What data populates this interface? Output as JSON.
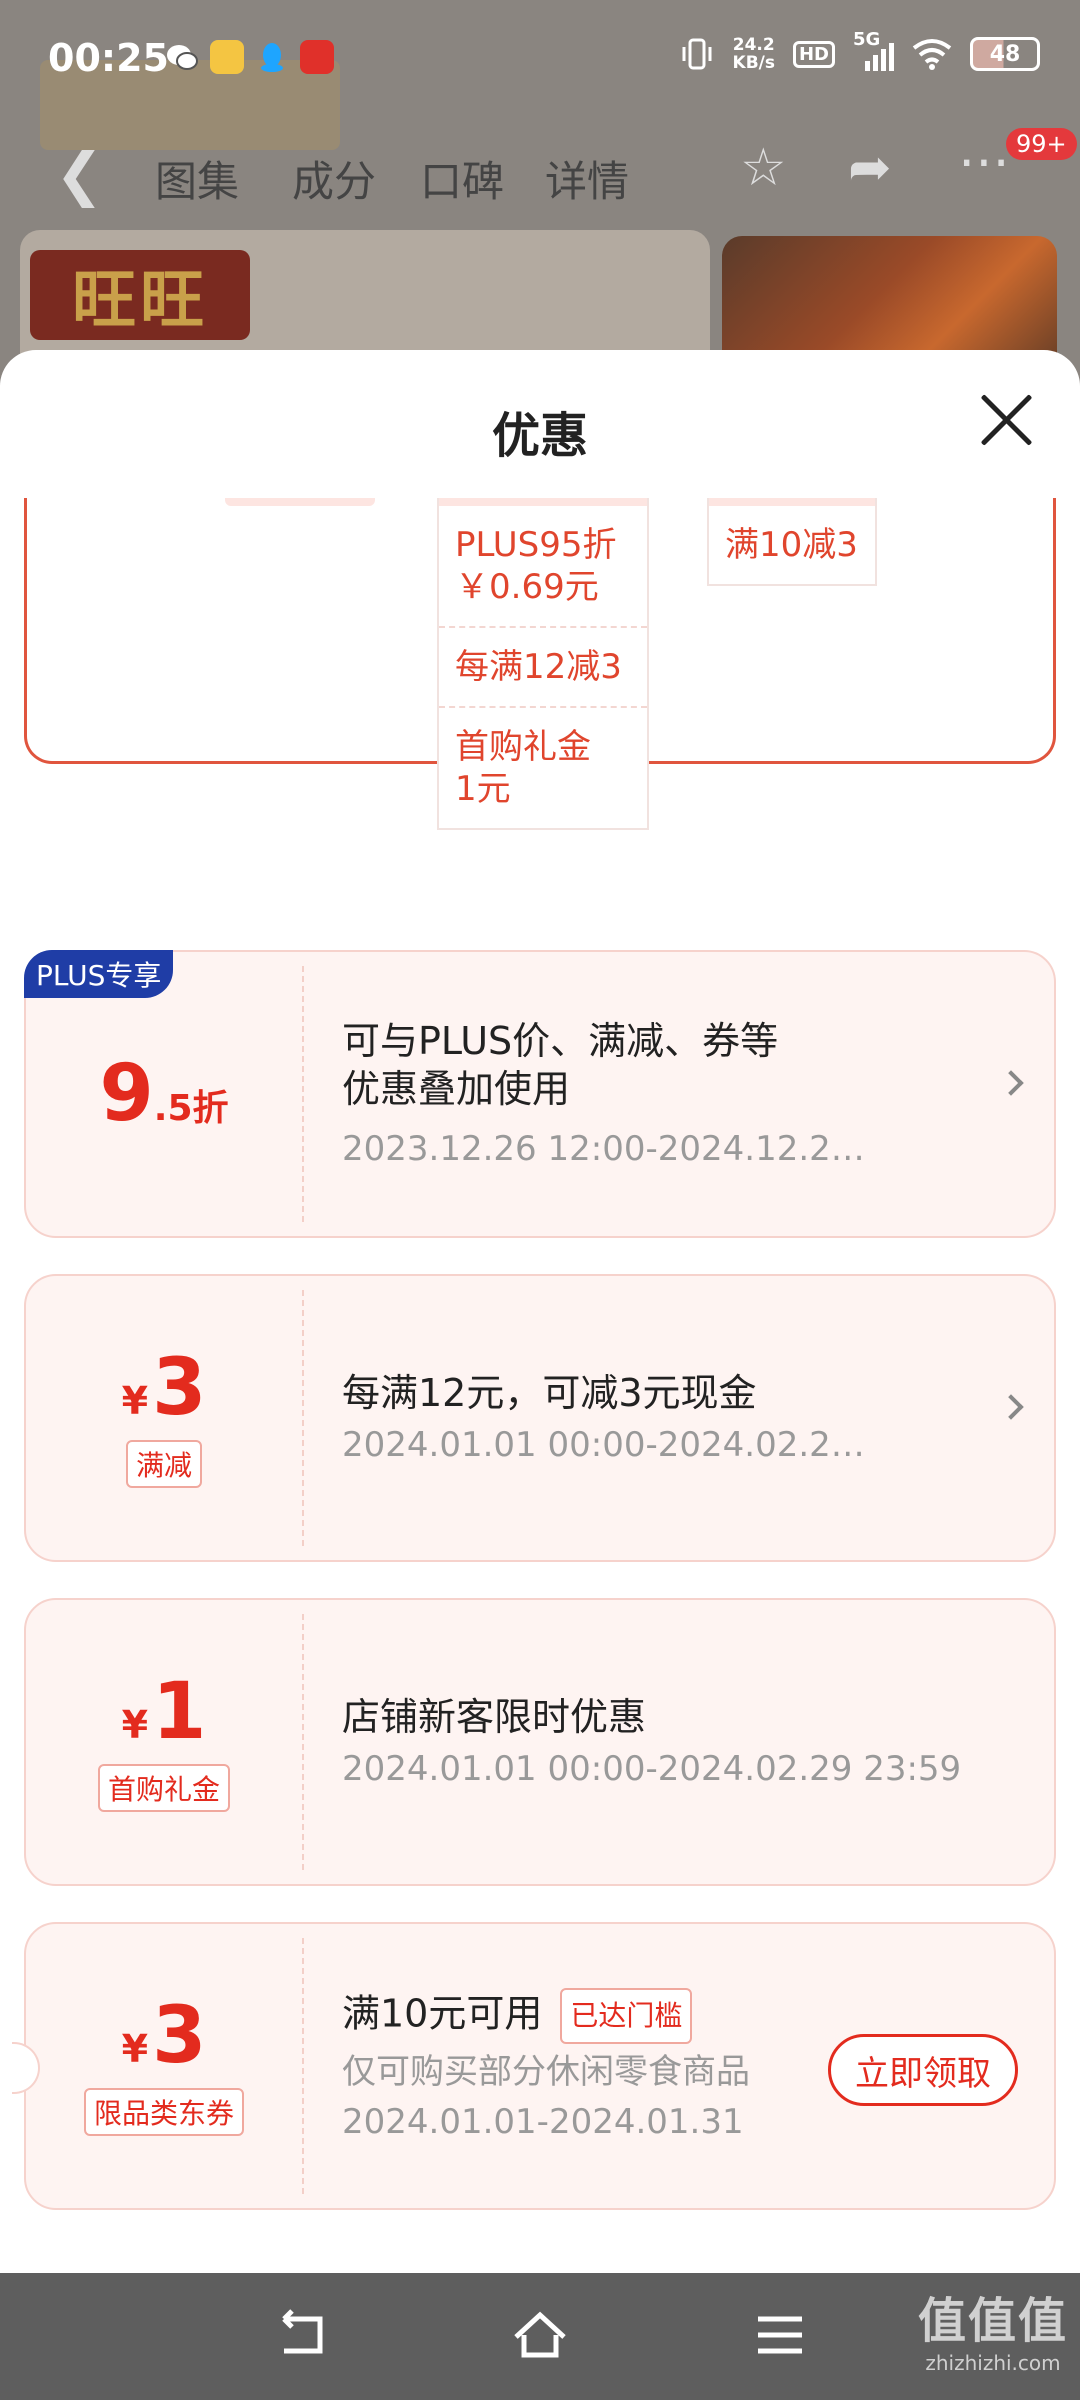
{
  "status": {
    "time": "00:25",
    "net_speed_value": "24.2",
    "net_speed_unit": "KB/s",
    "hd": "HD",
    "network": "5G",
    "battery": "48"
  },
  "background_page": {
    "logo_text": "旺旺",
    "tabs": [
      "图集",
      "成分",
      "口碑",
      "详情"
    ],
    "cart_badge": "99+"
  },
  "sheet": {
    "title": "优惠"
  },
  "summary": {
    "col2": [
      "PLUS95折\n￥0.69元",
      "每满12减3",
      "首购礼金\n1元"
    ],
    "col3": [
      "满10减3"
    ]
  },
  "coupons": [
    {
      "badge": "PLUS专享",
      "currency": "",
      "amount": "9",
      "amount_suffix": ".5折",
      "tag": "",
      "title": "可与PLUS价、满减、券等\n优惠叠加使用",
      "desc": "",
      "period": "2023.12.26 12:00-2024.12.2…",
      "has_arrow": true
    },
    {
      "badge": "",
      "currency": "¥",
      "amount": "3",
      "amount_suffix": "",
      "tag": "满减",
      "title": "每满12元，可减3元现金",
      "desc": "",
      "period": "2024.01.01 00:00-2024.02.2…",
      "has_arrow": true
    },
    {
      "badge": "",
      "currency": "¥",
      "amount": "1",
      "amount_suffix": "",
      "tag": "首购礼金",
      "title": "店铺新客限时优惠",
      "desc": "",
      "period": "2024.01.01 00:00-2024.02.29 23:59",
      "has_arrow": false
    },
    {
      "badge": "",
      "currency": "¥",
      "amount": "3",
      "amount_suffix": "",
      "tag": "限品类东券",
      "title": "满10元可用",
      "title_tag": "已达门槛",
      "desc": "仅可购买部分休闲零食商品",
      "period": "2024.01.01-2024.01.31",
      "button": "立即领取",
      "has_arrow": false
    }
  ],
  "watermark": {
    "line1": "值值值",
    "line2": "zhizhizhi.com"
  },
  "colors": {
    "accent": "#e32b1e",
    "card_bg": "#fef4f2",
    "plus_badge": "#1f3da6"
  }
}
